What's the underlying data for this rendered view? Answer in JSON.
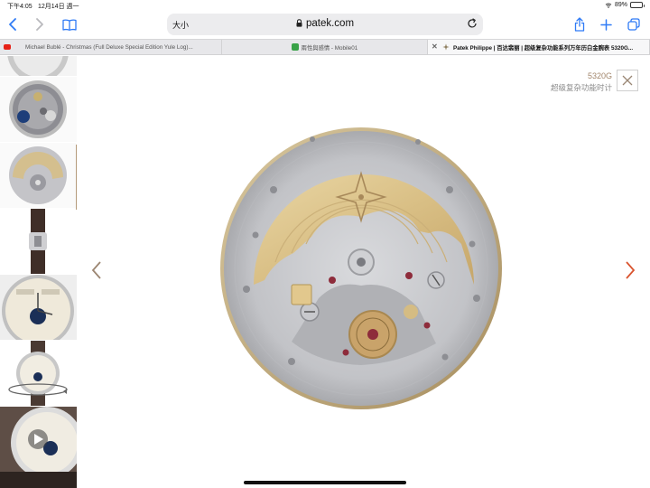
{
  "status_bar": {
    "time": "下午4:05",
    "date": "12月14日 週一",
    "battery": "89%",
    "battery_level": 0.89
  },
  "address_bar": {
    "text_size_label": "大小",
    "domain": "patek.com"
  },
  "tabs": [
    {
      "label": "Michael Bublé - Christmas (Full Deluxe Special Edition Yule Log)...",
      "favicon": "youtube-icon",
      "favicon_color": "#e62117",
      "active": false
    },
    {
      "label": "兩性與感情 - Mobile01",
      "favicon": "mobile01-icon",
      "favicon_color": "#39a248",
      "active": false
    },
    {
      "label": "Patek Philippe | 百达翡丽 | 超级复杂功能系列万年历白金腕表 5320G...",
      "favicon": "patek-calatrava-cross-icon",
      "favicon_color": "#8a7a5a",
      "active": true
    }
  ],
  "gallery": {
    "thumbnails": [
      {
        "name": "thumb-strap-crop"
      },
      {
        "name": "thumb-caseback-front"
      },
      {
        "name": "thumb-movement-rotor",
        "selected": true
      },
      {
        "name": "thumb-side-profile"
      },
      {
        "name": "thumb-dial-closeup"
      },
      {
        "name": "thumb-dial-360"
      },
      {
        "name": "thumb-video"
      }
    ]
  },
  "product": {
    "reference": "5320G",
    "description": "超级复杂功能时计"
  },
  "colors": {
    "accent_gold": "#a2866c",
    "next_arrow": "#d9542f",
    "prev_arrow": "#9c8672"
  }
}
